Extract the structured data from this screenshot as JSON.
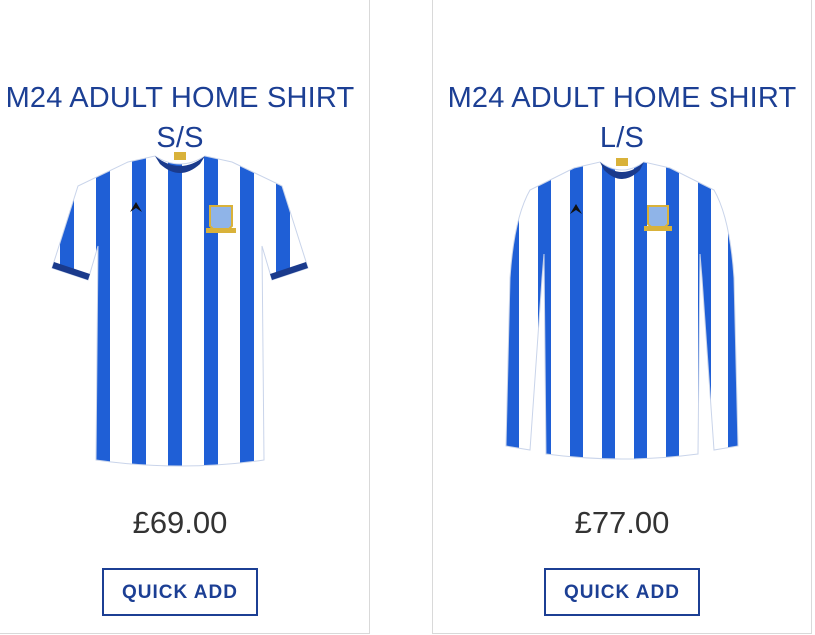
{
  "products": [
    {
      "title_line1": "M24 ADULT HOME SHIRT",
      "title_line2": "S/S",
      "price": "£69.00",
      "button_label": "QUICK ADD"
    },
    {
      "title_line1": "M24 ADULT HOME SHIRT",
      "title_line2": "L/S",
      "price": "£77.00",
      "button_label": "QUICK ADD"
    }
  ],
  "colors": {
    "brand_blue": "#1c3f94",
    "stripe_blue": "#1f5fd6",
    "price_text": "#333333"
  }
}
